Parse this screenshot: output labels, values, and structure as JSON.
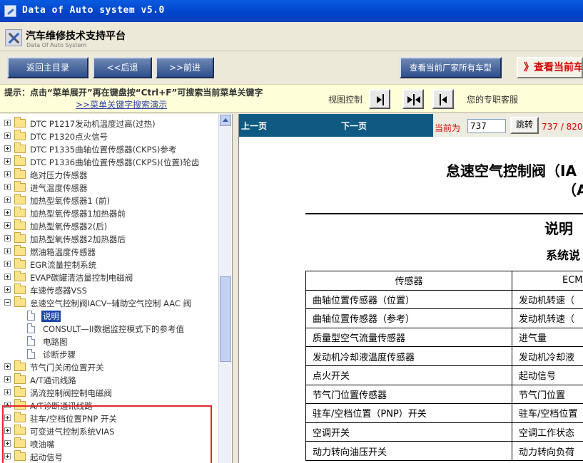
{
  "window": {
    "title": "Data of Auto system v5.0"
  },
  "header": {
    "title": "汽车维修技术支持平台",
    "subtitle": "Data Of Auto System"
  },
  "navbar": {
    "home": "返回主目录",
    "back": "<<后退",
    "forward": ">>前进",
    "all_models": "查看当前厂家所有车型",
    "current_model": "》查看当前车型"
  },
  "hintbar": {
    "hint": "提示：点击“菜单展开”再在键盘按“Ctrl+F”可搜索当前菜单关键字",
    "demo_link": ">>菜单关键字搜索演示",
    "view_label": "视图控制",
    "support": "您的专职客服"
  },
  "tree": {
    "items": [
      "DTC P1217发动机温度过高(过热)",
      "DTC P1320点火信号",
      "DTC P1335曲轴位置传感器(CKPS)参考",
      "DTC P1336曲轴位置传感器(CKPS)(位置)轮齿",
      "绝对压力传感器",
      "进气温度传感器",
      "加热型氧传感器1 (前)",
      "加热型氧传感器1加热器前",
      "加热型氧传感器2(后)",
      "加热型氧传感器2加热器后",
      "燃油箱温度传感器",
      "EGR流量控制系统",
      "EVAP碳罐清洁量控制电磁阀",
      "车速传感器VSS",
      "怠速空气控制阀IACV─辅助空气控制 AAC 阀",
      "节气门关闭位置开关",
      "A/T通讯线路",
      "涡流控制阀控制电磁阀",
      "A/T诊断通讯线路",
      "驻车/空档位置PNP 开关",
      "可变进气控制系统VIAS",
      "喷油嘴",
      "起动信号"
    ],
    "children": [
      "说明",
      "CONSULT—II数据监控模式下的参考值",
      "电路图",
      "诊断步骤"
    ]
  },
  "pager": {
    "prev": "上一页",
    "next": "下一页",
    "current_label": "当前为",
    "current_page": "737",
    "jump": "跳转",
    "count": "737 / 820"
  },
  "document": {
    "title_line1": "怠速空气控制阀（IA",
    "title_line2": "（AA",
    "heading": "说明",
    "subheading": "系统说",
    "table": {
      "headers": [
        "传感器",
        "ECM"
      ],
      "rows": [
        [
          "曲轴位置传感器（位置）",
          "发动机转速（"
        ],
        [
          "曲轴位置传感器（参考）",
          "发动机转速（"
        ],
        [
          "质量型空气流量传感器",
          "进气量"
        ],
        [
          "发动机冷却液温度传感器",
          "发动机冷却液"
        ],
        [
          "点火开关",
          "起动信号"
        ],
        [
          "节气门位置传感器",
          "节气门位置"
        ],
        [
          "驻车/空档位置（PNP）开关",
          "驻车/空档位置"
        ],
        [
          "空调开关",
          "空调工作状态"
        ],
        [
          "动力转向油压开关",
          "动力转向负荷"
        ]
      ]
    }
  },
  "colors": {
    "title_bar": "#0043c9",
    "pager_bar": "#0e5a82",
    "alert_red": "#d40000",
    "selection": "#1b46a6",
    "highlight_box": "#e0282e"
  }
}
